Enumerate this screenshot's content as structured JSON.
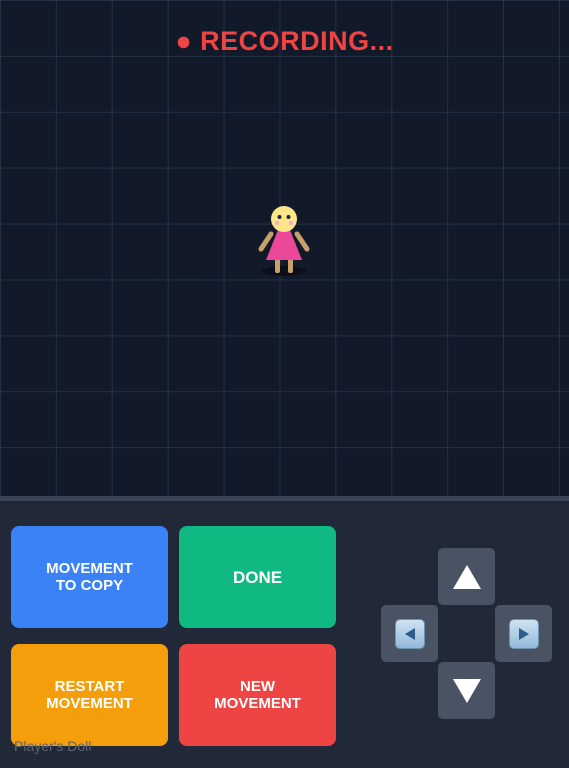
{
  "status": {
    "recording_text": "● RECORDING...",
    "color": "#ef4444"
  },
  "character": {
    "name": "doll",
    "caption": "Player's Doll"
  },
  "buttons": {
    "movement_to_copy": "MOVEMENT TO COPY",
    "done": "DONE",
    "restart_movement": "RESTART MOVEMENT",
    "new_movement": "NEW MOVEMENT"
  },
  "dpad": {
    "up_icon": "triangle-up-icon",
    "left_icon": "left-arrow-key-icon",
    "right_icon": "right-arrow-key-icon",
    "down_icon": "triangle-down-icon"
  },
  "colors": {
    "blue": "#3b82f6",
    "green": "#10b981",
    "orange": "#f59e0b",
    "red": "#ef4444"
  }
}
